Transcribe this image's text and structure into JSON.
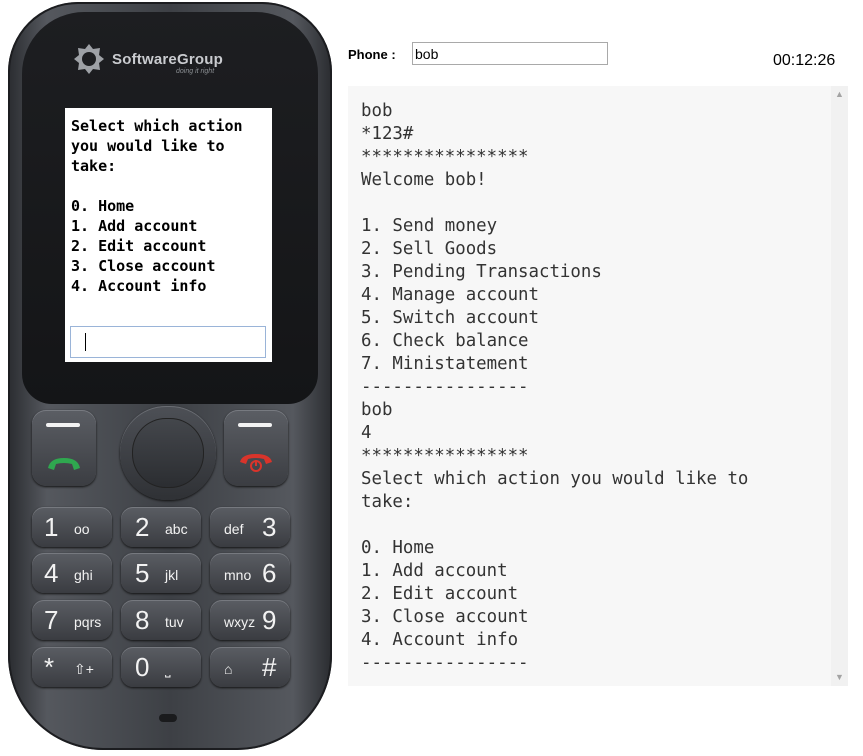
{
  "brand": {
    "name": "SoftwareGroup",
    "tagline": "doing it right"
  },
  "phone_screen": {
    "menu_text": "Select which action you would like to take:\n\n0. Home\n1. Add account\n2. Edit account\n3. Close account\n4. Account info",
    "input_value": ""
  },
  "keypad": [
    {
      "num": "1",
      "sub": "oo"
    },
    {
      "num": "2",
      "sub": "abc"
    },
    {
      "num": "3",
      "sub": "def"
    },
    {
      "num": "4",
      "sub": "ghi"
    },
    {
      "num": "5",
      "sub": "jkl"
    },
    {
      "num": "6",
      "sub": "mno"
    },
    {
      "num": "7",
      "sub": "pqrs"
    },
    {
      "num": "8",
      "sub": "tuv"
    },
    {
      "num": "9",
      "sub": "wxyz"
    },
    {
      "num": "*",
      "sub": "⇧+"
    },
    {
      "num": "0",
      "sub": "⎵"
    },
    {
      "num": "#",
      "sub": "⌂"
    }
  ],
  "header": {
    "phone_label": "Phone :",
    "phone_value": "bob",
    "clock": "00:12:26"
  },
  "console": {
    "text": "bob\n*123#\n****************\nWelcome bob!\n\n1. Send money\n2. Sell Goods\n3. Pending Transactions\n4. Manage account\n5. Switch account\n6. Check balance\n7. Ministatement\n----------------\nbob\n4\n****************\nSelect which action you would like to\ntake:\n\n0. Home\n1. Add account\n2. Edit account\n3. Close account\n4. Account info\n----------------"
  },
  "colors": {
    "call_green": "#2fa84f",
    "end_red": "#d9342b",
    "console_bg": "#f7f7f7"
  },
  "icons": [
    "softwaregroup-logo-icon",
    "call-icon",
    "end-call-icon",
    "scroll-up-arrow-icon",
    "scroll-down-arrow-icon"
  ]
}
